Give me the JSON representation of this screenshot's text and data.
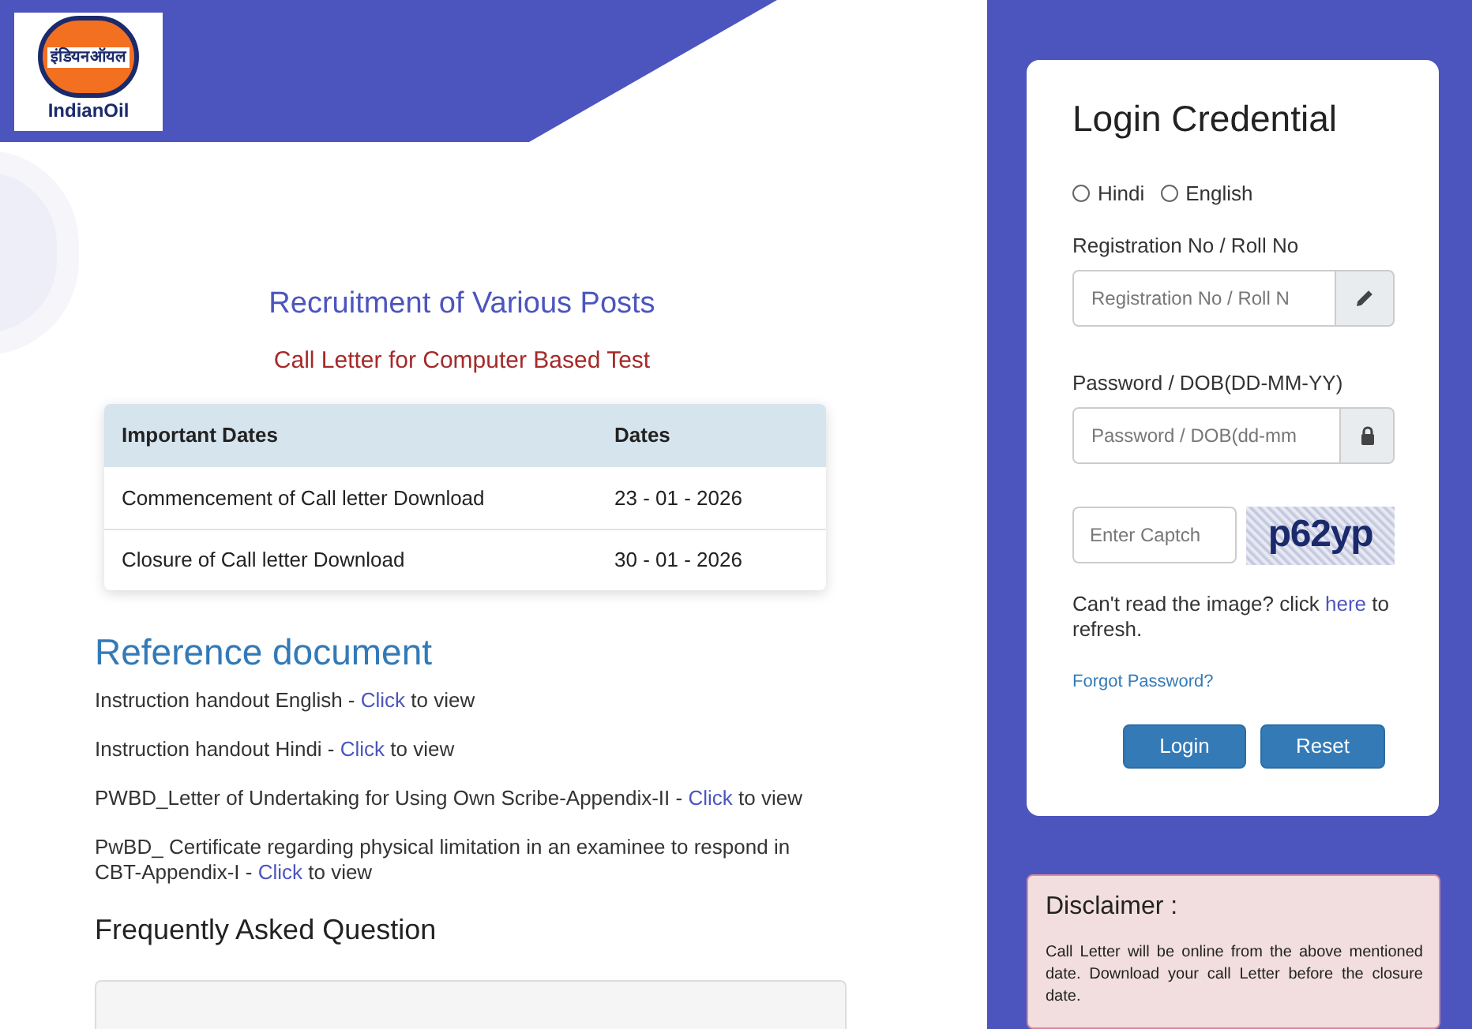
{
  "logo": {
    "hindi": "इंडियनऑयल",
    "name": "IndianOil"
  },
  "title": "Recruitment of Various Posts",
  "subtitle": "Call Letter for Computer Based Test",
  "dates_table": {
    "columns": [
      "Important Dates",
      "Dates"
    ],
    "rows": [
      {
        "cells": [
          "Commencement of Call letter Download",
          "23 - 01 - 2026"
        ]
      },
      {
        "cells": [
          "Closure of Call letter Download",
          "30 - 01 - 2026"
        ]
      }
    ]
  },
  "reference": {
    "heading": "Reference document",
    "items": [
      {
        "before": "Instruction handout English - ",
        "link": "Click",
        "after": " to view"
      },
      {
        "before": "Instruction handout Hindi - ",
        "link": "Click",
        "after": " to view"
      },
      {
        "before": "PWBD_Letter of Undertaking for Using Own Scribe-Appendix-II - ",
        "link": "Click",
        "after": " to view"
      },
      {
        "before": "PwBD_ Certificate regarding physical limitation in an examinee to respond in CBT-Appendix-I - ",
        "link": "Click",
        "after": " to view"
      }
    ]
  },
  "faq": {
    "heading": "Frequently Asked Question"
  },
  "login": {
    "title": "Login Credential",
    "languages": [
      {
        "label": "Hindi",
        "selected": false
      },
      {
        "label": "English",
        "selected": false
      }
    ],
    "registration": {
      "label": "Registration No / Roll No",
      "placeholder": "Registration No / Roll N"
    },
    "password": {
      "label": "Password / DOB(DD-MM-YY)",
      "placeholder": "Password / DOB(dd-mm"
    },
    "captcha": {
      "placeholder": "Enter Captch",
      "code": "p62yp"
    },
    "refresh": {
      "before": "Can't read the image? click ",
      "link": "here",
      "after": " to refresh."
    },
    "forgot": "Forgot Password?",
    "buttons": [
      "Login",
      "Reset"
    ]
  },
  "disclaimer": {
    "title": "Disclaimer :",
    "text": "Call Letter will be online from the above mentioned date. Download your call Letter before the closure date."
  }
}
